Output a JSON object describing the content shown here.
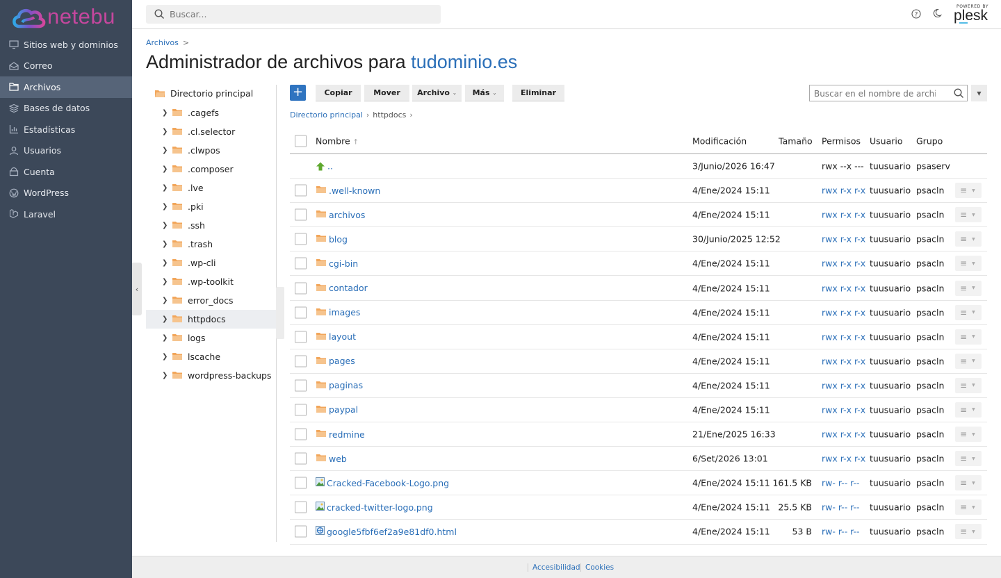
{
  "brand": {
    "name": "netebu",
    "powered_by": "POWERED BY",
    "plesk": "plesk"
  },
  "search": {
    "placeholder": "Buscar..."
  },
  "sidebar": {
    "items": [
      {
        "label": "Sitios web y dominios",
        "icon": "monitor-icon"
      },
      {
        "label": "Correo",
        "icon": "mail-icon"
      },
      {
        "label": "Archivos",
        "icon": "folder-icon",
        "active": true
      },
      {
        "label": "Bases de datos",
        "icon": "database-icon"
      },
      {
        "label": "Estadísticas",
        "icon": "bar-chart-icon"
      },
      {
        "label": "Usuarios",
        "icon": "user-icon"
      },
      {
        "label": "Cuenta",
        "icon": "account-icon"
      },
      {
        "label": "WordPress",
        "icon": "wordpress-icon"
      },
      {
        "label": "Laravel",
        "icon": "laravel-icon"
      }
    ]
  },
  "breadcrumb": {
    "root": "Archivos",
    "sep": ">"
  },
  "title": {
    "prefix": "Administrador de archivos para",
    "domain": "tudominio.es"
  },
  "tree": {
    "root": "Directorio principal",
    "items": [
      ".cagefs",
      ".cl.selector",
      ".clwpos",
      ".composer",
      ".lve",
      ".pki",
      ".ssh",
      ".trash",
      ".wp-cli",
      ".wp-toolkit",
      "error_docs",
      "httpdocs",
      "logs",
      "lscache",
      "wordpress-backups"
    ],
    "selected": "httpdocs"
  },
  "toolbar": {
    "add": "+",
    "copy": "Copiar",
    "move": "Mover",
    "file": "Archivo",
    "more": "Más",
    "delete": "Eliminar",
    "search_placeholder": "Buscar en el nombre de archivo"
  },
  "path": {
    "root": "Directorio principal",
    "current": "httpdocs"
  },
  "table": {
    "headers": {
      "name": "Nombre",
      "modified": "Modificación",
      "size": "Tamaño",
      "perms": "Permisos",
      "user": "Usuario",
      "group": "Grupo"
    },
    "parent": {
      "name": "..",
      "modified": "3/Junio/2026 16:47",
      "perms": "rwx --x ---",
      "user": "tuusuario",
      "group": "psaserv"
    },
    "rows": [
      {
        "name": ".well-known",
        "type": "folder",
        "modified": "4/Ene/2024 15:11",
        "size": "",
        "perms": "rwx r-x r-x",
        "user": "tuusuario",
        "group": "psacln"
      },
      {
        "name": "archivos",
        "type": "folder",
        "modified": "4/Ene/2024 15:11",
        "size": "",
        "perms": "rwx r-x r-x",
        "user": "tuusuario",
        "group": "psacln"
      },
      {
        "name": "blog",
        "type": "folder",
        "modified": "30/Junio/2025 12:52",
        "size": "",
        "perms": "rwx r-x r-x",
        "user": "tuusuario",
        "group": "psacln"
      },
      {
        "name": "cgi-bin",
        "type": "folder",
        "modified": "4/Ene/2024 15:11",
        "size": "",
        "perms": "rwx r-x r-x",
        "user": "tuusuario",
        "group": "psacln"
      },
      {
        "name": "contador",
        "type": "folder",
        "modified": "4/Ene/2024 15:11",
        "size": "",
        "perms": "rwx r-x r-x",
        "user": "tuusuario",
        "group": "psacln"
      },
      {
        "name": "images",
        "type": "folder",
        "modified": "4/Ene/2024 15:11",
        "size": "",
        "perms": "rwx r-x r-x",
        "user": "tuusuario",
        "group": "psacln"
      },
      {
        "name": "layout",
        "type": "folder",
        "modified": "4/Ene/2024 15:11",
        "size": "",
        "perms": "rwx r-x r-x",
        "user": "tuusuario",
        "group": "psacln"
      },
      {
        "name": "pages",
        "type": "folder",
        "modified": "4/Ene/2024 15:11",
        "size": "",
        "perms": "rwx r-x r-x",
        "user": "tuusuario",
        "group": "psacln"
      },
      {
        "name": "paginas",
        "type": "folder",
        "modified": "4/Ene/2024 15:11",
        "size": "",
        "perms": "rwx r-x r-x",
        "user": "tuusuario",
        "group": "psacln"
      },
      {
        "name": "paypal",
        "type": "folder",
        "modified": "4/Ene/2024 15:11",
        "size": "",
        "perms": "rwx r-x r-x",
        "user": "tuusuario",
        "group": "psacln"
      },
      {
        "name": "redmine",
        "type": "folder",
        "modified": "21/Ene/2025 16:33",
        "size": "",
        "perms": "rwx r-x r-x",
        "user": "tuusuario",
        "group": "psacln"
      },
      {
        "name": "web",
        "type": "folder",
        "modified": "6/Set/2026 13:01",
        "size": "",
        "perms": "rwx r-x r-x",
        "user": "tuusuario",
        "group": "psacln"
      },
      {
        "name": "Cracked-Facebook-Logo.png",
        "type": "image",
        "modified": "4/Ene/2024 15:11",
        "size": "161.5 KB",
        "perms": "rw- r-- r--",
        "user": "tuusuario",
        "group": "psacln"
      },
      {
        "name": "cracked-twitter-logo.png",
        "type": "image",
        "modified": "4/Ene/2024 15:11",
        "size": "25.5 KB",
        "perms": "rw- r-- r--",
        "user": "tuusuario",
        "group": "psacln"
      },
      {
        "name": "google5fbf6ef2a9e81df0.html",
        "type": "html",
        "modified": "4/Ene/2024 15:11",
        "size": "53 B",
        "perms": "rw- r-- r--",
        "user": "tuusuario",
        "group": "psacln"
      }
    ]
  },
  "footer": {
    "accessibility": "Accesibilidad",
    "cookies": "Cookies"
  }
}
